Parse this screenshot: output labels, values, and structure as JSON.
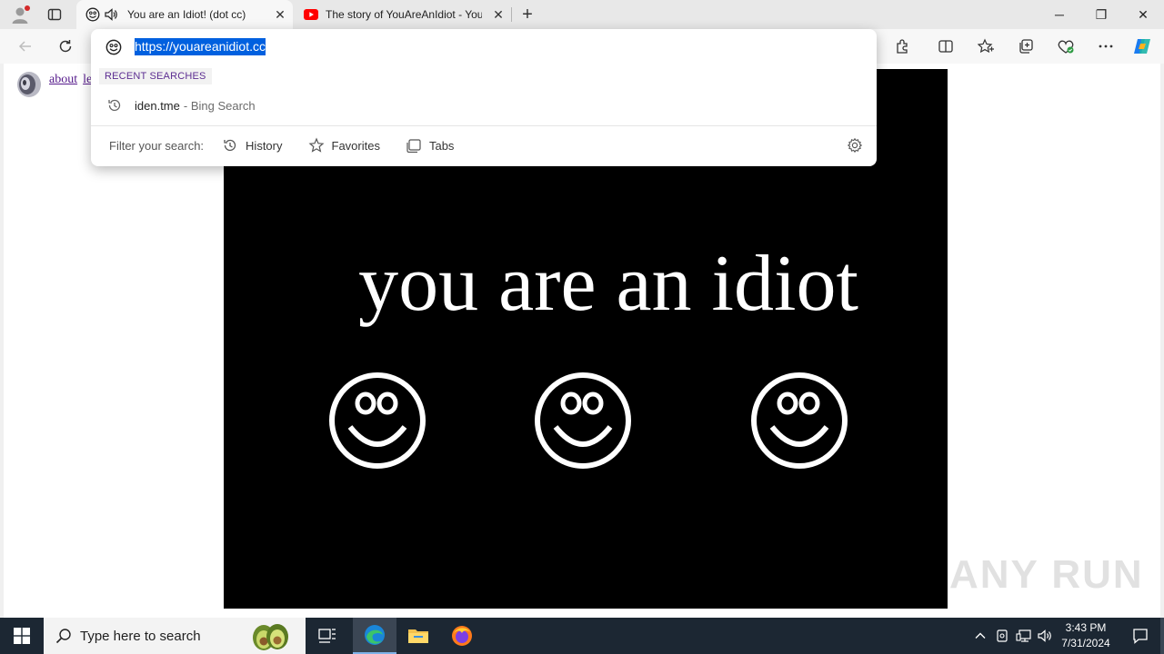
{
  "browser": {
    "tabs": [
      {
        "title": "You are an Idiot! (dot cc)",
        "icon": "smiley-icon",
        "audio": true
      },
      {
        "title": "The story of YouAreAnIdiot - You",
        "icon": "youtube-icon"
      }
    ],
    "new_tab_symbol": "+",
    "window_controls": {
      "minimize": "─",
      "restore": "❐",
      "close": "✕"
    }
  },
  "omnibox": {
    "url": "https://youareanidiot.cc",
    "recent_label": "RECENT SEARCHES",
    "recent": [
      {
        "main": "iden.tme",
        "sub": "- Bing Search"
      }
    ],
    "filter_label": "Filter your search:",
    "filters": [
      "History",
      "Favorites",
      "Tabs"
    ]
  },
  "page": {
    "links": [
      "about",
      "le"
    ],
    "headline": "you are an idiot",
    "watermark": "ANY RUN",
    "stage_color": "#000000"
  },
  "taskbar": {
    "search_placeholder": "Type here to search",
    "time": "3:43 PM",
    "date": "7/31/2024"
  }
}
